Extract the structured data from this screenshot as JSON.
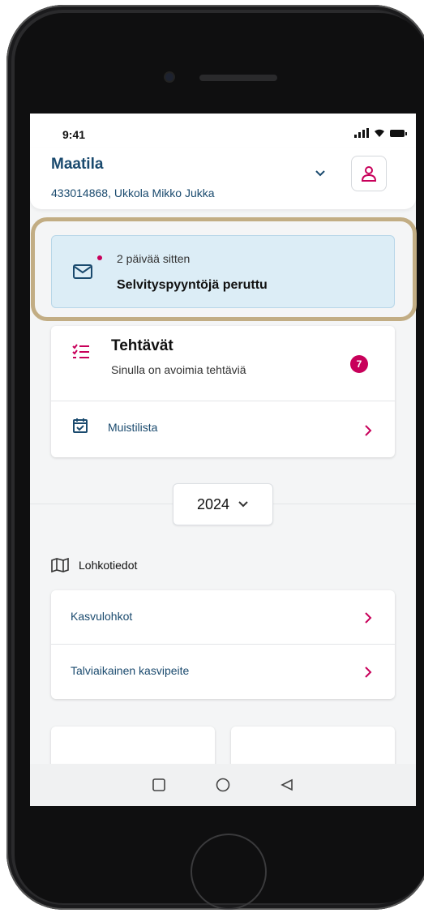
{
  "status_bar": {
    "time": "9:41"
  },
  "header": {
    "title": "Maatila",
    "subtitle": "433014868, Ukkola Mikko Jukka"
  },
  "notification": {
    "time": "2 päivää sitten",
    "title": "Selvityspyyntöjä peruttu",
    "icon": "mail-icon"
  },
  "tasks": {
    "title": "Tehtävät",
    "subtitle": "Sinulla on avoimia tehtäviä",
    "badge": "7",
    "memo_label": "Muistilista"
  },
  "year": {
    "selected": "2024"
  },
  "plots": {
    "section_label": "Lohkotiedot",
    "items": [
      {
        "label": "Kasvulohkot"
      },
      {
        "label": "Talviaikainen kasvipeite"
      }
    ]
  },
  "colors": {
    "accent": "#c8005a",
    "primary_text": "#1a4a6e",
    "notification_bg": "#dcedf6",
    "highlight": "#c2ad84"
  }
}
